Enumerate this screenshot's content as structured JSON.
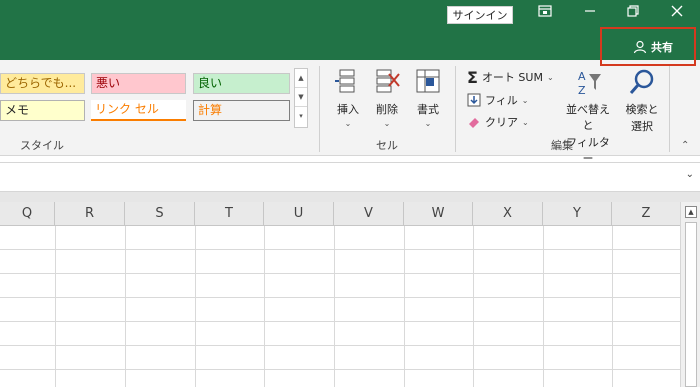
{
  "titlebar": {
    "signin_label": "サインイン",
    "share_label": "共有",
    "bg_color": "#217346",
    "highlight_color": "#d4391e"
  },
  "styles": {
    "cells": [
      {
        "label": "どちらでも...",
        "bg": "#ffeb9c",
        "fg": "#9c6500"
      },
      {
        "label": "悪い",
        "bg": "#ffc7ce",
        "fg": "#9c0006"
      },
      {
        "label": "良い",
        "bg": "#c6efce",
        "fg": "#006100"
      },
      {
        "label": "メモ",
        "bg": "#ffffcc",
        "fg": "#262626"
      },
      {
        "label": "リンク セル",
        "bg": "#ffffff",
        "fg": "#fa7d00"
      },
      {
        "label": "計算",
        "bg": "#f2f2f2",
        "fg": "#fa7d00"
      }
    ],
    "group_label": "スタイル"
  },
  "cells_group": {
    "insert_label": "挿入",
    "delete_label": "削除",
    "format_label": "書式",
    "group_label": "セル"
  },
  "editing": {
    "autosum_label": "オート SUM",
    "fill_label": "フィル",
    "clear_label": "クリア",
    "sort_label_1": "並べ替えと",
    "sort_label_2": "フィルター",
    "find_label_1": "検索と",
    "find_label_2": "選択",
    "group_label": "編集"
  },
  "sheet": {
    "columns": [
      "Q",
      "R",
      "S",
      "T",
      "U",
      "V",
      "W",
      "X",
      "Y",
      "Z"
    ]
  }
}
